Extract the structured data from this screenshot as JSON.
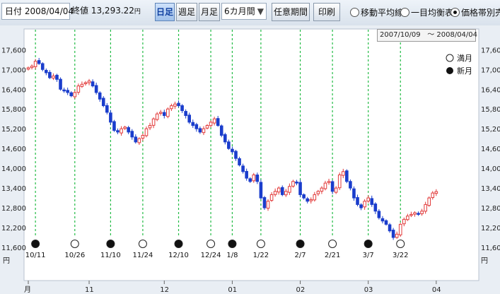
{
  "toolbar": {
    "date_label": "日付",
    "date_value": "2008/04/04",
    "close_label": "終値",
    "close_value": "13,293.22",
    "close_unit": "円",
    "tabs": [
      "日足",
      "週足",
      "月足"
    ],
    "period_value": "6カ月間",
    "period_arrow": "▼",
    "range_button": "任意期間",
    "print_button": "印刷",
    "radios": [
      {
        "label": "移動平均線",
        "selected": false
      },
      {
        "label": "一目均衡表",
        "selected": false
      },
      {
        "label": "価格帯別売買",
        "selected": true
      }
    ]
  },
  "date_range": {
    "from": "2007/10/09",
    "to": "2008/04/04",
    "sep": "〜"
  },
  "legend": {
    "full_moon": "満月",
    "new_moon": "新月"
  },
  "colors": {
    "up": "#e23a3a",
    "down": "#1a3dcc",
    "grid": "#22bb44",
    "ma": "#8a4a8a"
  },
  "chart_data": {
    "type": "candlestick",
    "y_unit": "円",
    "y_ticks": [
      11600,
      12200,
      12800,
      13400,
      14000,
      14600,
      15200,
      15800,
      16400,
      17000,
      17600
    ],
    "ylim": [
      11600,
      17800
    ],
    "x_month_labels": [
      {
        "label": "月",
        "i": 0
      },
      {
        "label": "11",
        "i": 17
      },
      {
        "label": "12",
        "i": 38
      },
      {
        "label": "01",
        "i": 57
      },
      {
        "label": "02",
        "i": 76
      },
      {
        "label": "03",
        "i": 95
      },
      {
        "label": "04",
        "i": 114
      }
    ],
    "moon_phases": [
      {
        "date": "10/11",
        "phase": "new",
        "i": 2
      },
      {
        "date": "10/26",
        "phase": "full",
        "i": 13
      },
      {
        "date": "11/10",
        "phase": "new",
        "i": 23
      },
      {
        "date": "11/24",
        "phase": "full",
        "i": 32
      },
      {
        "date": "12/10",
        "phase": "new",
        "i": 42
      },
      {
        "date": "12/24",
        "phase": "full",
        "i": 51
      },
      {
        "date": "1/8",
        "phase": "new",
        "i": 57
      },
      {
        "date": "1/22",
        "phase": "full",
        "i": 65
      },
      {
        "date": "2/7",
        "phase": "new",
        "i": 76
      },
      {
        "date": "2/21",
        "phase": "full",
        "i": 85
      },
      {
        "date": "3/7",
        "phase": "new",
        "i": 95
      },
      {
        "date": "3/22",
        "phase": "full",
        "i": 104
      }
    ],
    "closes": [
      17050,
      17100,
      17250,
      17180,
      17000,
      16900,
      16750,
      16800,
      16700,
      16400,
      16350,
      16300,
      16200,
      16300,
      16500,
      16550,
      16600,
      16650,
      16500,
      16300,
      16100,
      15900,
      15700,
      15400,
      15150,
      15100,
      15200,
      15250,
      15100,
      14950,
      14800,
      14900,
      15000,
      15200,
      15300,
      15500,
      15650,
      15700,
      15600,
      15800,
      15900,
      15950,
      15900,
      15750,
      15600,
      15400,
      15300,
      15200,
      15100,
      15200,
      15300,
      15400,
      15500,
      15300,
      15000,
      14800,
      14600,
      14500,
      14300,
      14100,
      13900,
      13700,
      13600,
      13800,
      13600,
      13100,
      12800,
      13000,
      13200,
      13300,
      13400,
      13200,
      13300,
      13450,
      13600,
      13550,
      13200,
      13100,
      13000,
      13050,
      13200,
      13300,
      13400,
      13550,
      13600,
      13300,
      13400,
      13800,
      13900,
      13600,
      13400,
      13100,
      12900,
      12800,
      13000,
      13100,
      12900,
      12700,
      12500,
      12400,
      12300,
      12100,
      11900,
      12000,
      12300,
      12450,
      12550,
      12600,
      12650,
      12600,
      12700,
      12900,
      13100,
      13250,
      13293
    ]
  }
}
